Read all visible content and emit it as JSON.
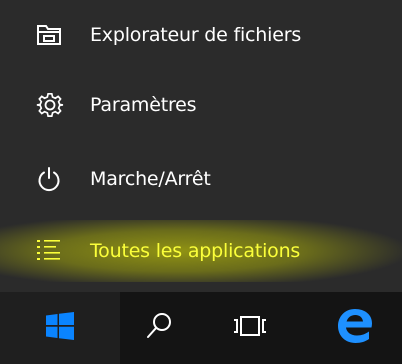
{
  "menu": {
    "items": [
      {
        "label": "Explorateur de fichiers",
        "icon": "file-explorer-icon"
      },
      {
        "label": "Paramètres",
        "icon": "gear-icon"
      },
      {
        "label": "Marche/Arrêt",
        "icon": "power-icon"
      },
      {
        "label": "Toutes les applications",
        "icon": "list-icon"
      }
    ],
    "highlight_color": "#e4e800",
    "highlight_text_color": "#fbff3a"
  },
  "taskbar": {
    "buttons": [
      {
        "icon": "windows-logo-icon"
      },
      {
        "icon": "search-icon"
      },
      {
        "icon": "task-view-icon"
      },
      {
        "icon": "edge-icon"
      }
    ],
    "accent_color": "#0a84ff"
  }
}
